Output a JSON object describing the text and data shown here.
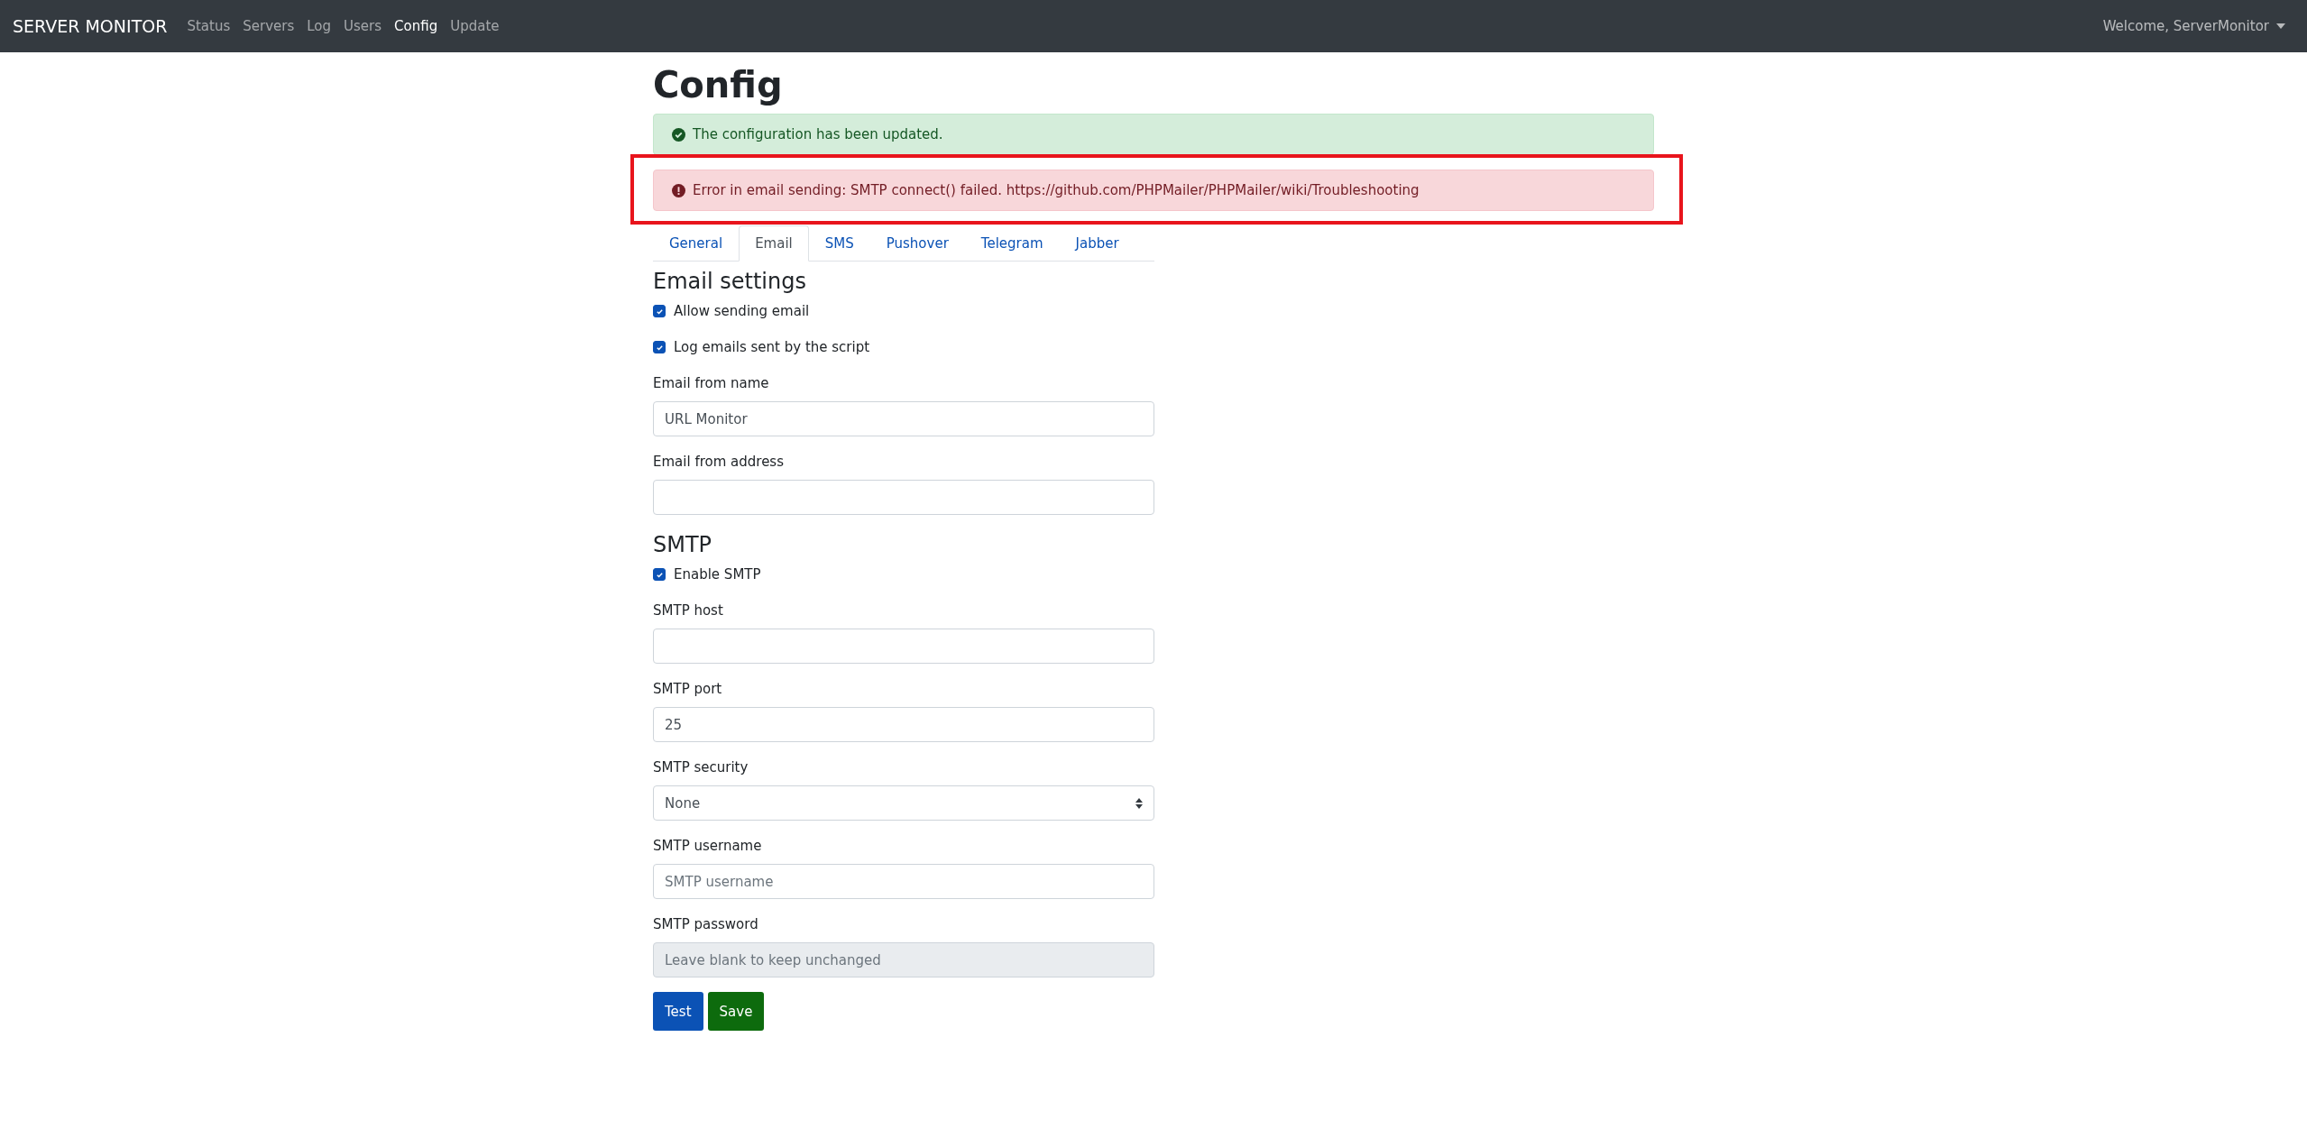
{
  "navbar": {
    "brand": "SERVER MONITOR",
    "items": [
      {
        "label": "Status",
        "selected": false
      },
      {
        "label": "Servers",
        "selected": false
      },
      {
        "label": "Log",
        "selected": false
      },
      {
        "label": "Users",
        "selected": false
      },
      {
        "label": "Config",
        "selected": true
      },
      {
        "label": "Update",
        "selected": false
      }
    ],
    "user_menu": "Welcome, ServerMonitor"
  },
  "page_title": "Config",
  "alerts": [
    {
      "kind": "success",
      "text": "The configuration has been updated.",
      "highlighted": false
    },
    {
      "kind": "danger",
      "text": "Error in email sending: SMTP connect() failed. https://github.com/PHPMailer/PHPMailer/wiki/Troubleshooting",
      "highlighted": true
    }
  ],
  "tabs": [
    {
      "label": "General",
      "selected": false
    },
    {
      "label": "Email",
      "selected": true
    },
    {
      "label": "SMS",
      "selected": false
    },
    {
      "label": "Pushover",
      "selected": false
    },
    {
      "label": "Telegram",
      "selected": false
    },
    {
      "label": "Jabber",
      "selected": false
    }
  ],
  "sections": [
    {
      "heading": "Email settings",
      "controls": [
        {
          "kind": "checkbox",
          "label": "Allow sending email",
          "checked": true
        },
        {
          "kind": "checkbox",
          "label": "Log emails sent by the script",
          "checked": true
        },
        {
          "kind": "text",
          "label": "Email from name",
          "value": "URL Monitor",
          "disabled": false
        },
        {
          "kind": "text",
          "label": "Email from address",
          "disabled": false
        }
      ]
    },
    {
      "heading": "SMTP",
      "controls": [
        {
          "kind": "checkbox",
          "label": "Enable SMTP",
          "checked": true
        },
        {
          "kind": "text",
          "label": "SMTP host",
          "disabled": false
        },
        {
          "kind": "text",
          "label": "SMTP port",
          "value": "25",
          "disabled": false
        },
        {
          "kind": "select",
          "label": "SMTP security",
          "value": "None",
          "disabled": false
        },
        {
          "kind": "text",
          "label": "SMTP username",
          "placeholder": "SMTP username",
          "disabled": false
        },
        {
          "kind": "text",
          "label": "SMTP password",
          "placeholder": "Leave blank to keep unchanged",
          "disabled": true
        }
      ]
    }
  ],
  "buttons": [
    {
      "label": "Test",
      "kind": "primary"
    },
    {
      "label": "Save",
      "kind": "success"
    }
  ]
}
